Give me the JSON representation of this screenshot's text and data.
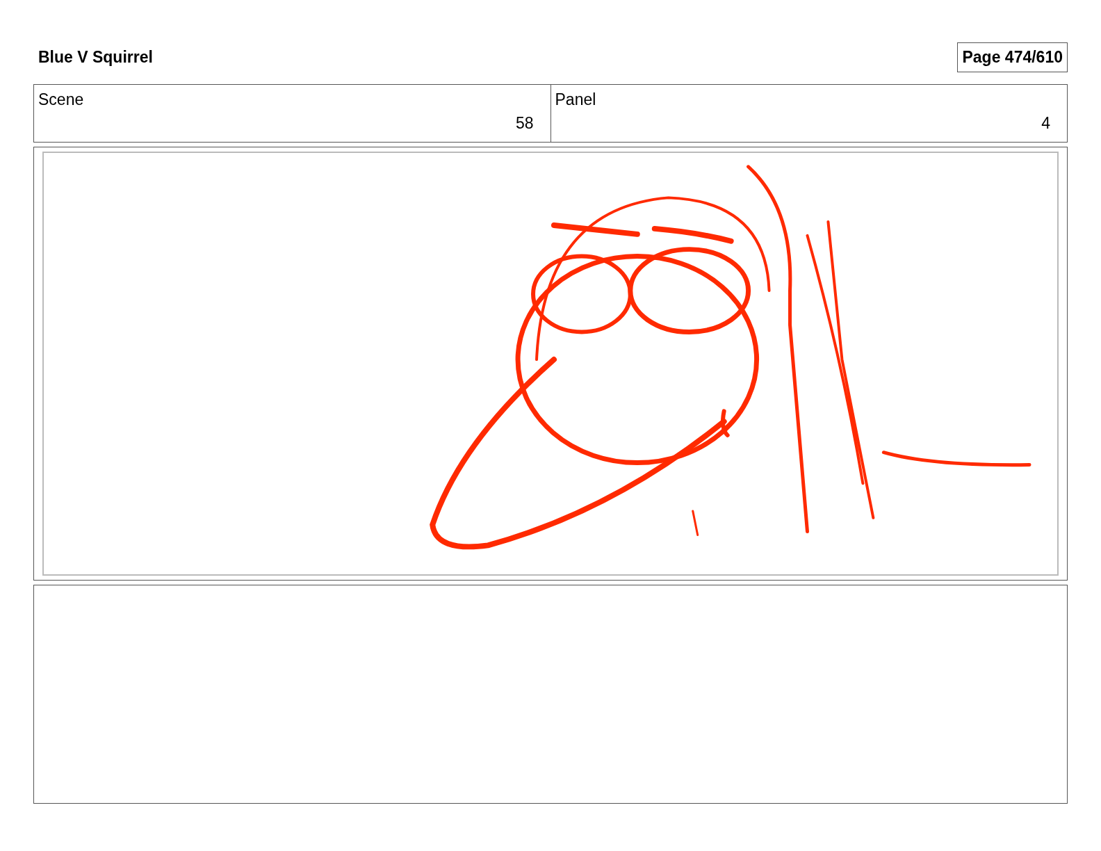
{
  "header": {
    "title": "Blue V Squirrel",
    "page": "Page 474/610"
  },
  "fields": [
    {
      "label": "Scene",
      "value": "58"
    },
    {
      "label": "Panel",
      "value": "4"
    }
  ]
}
